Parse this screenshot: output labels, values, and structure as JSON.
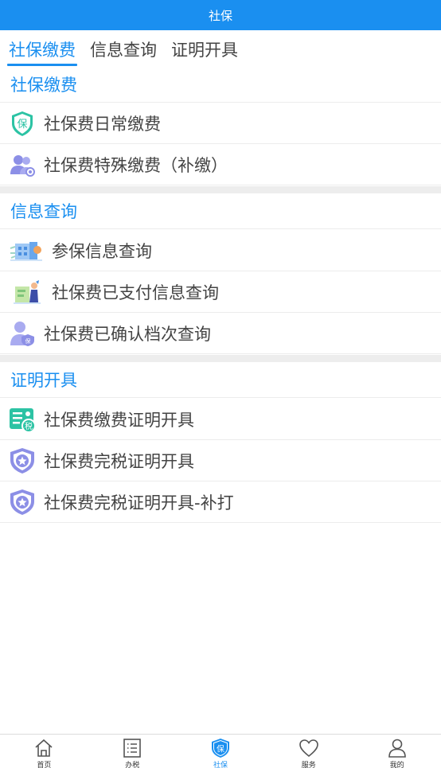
{
  "header": {
    "title": "社保"
  },
  "tabs": [
    {
      "label": "社保缴费",
      "active": true
    },
    {
      "label": "信息查询",
      "active": false
    },
    {
      "label": "证明开具",
      "active": false
    }
  ],
  "sections": [
    {
      "title": "社保缴费",
      "items": [
        {
          "label": "社保费日常缴费",
          "icon": "shield-bao-icon"
        },
        {
          "label": "社保费特殊缴费（补缴）",
          "icon": "people-group-icon"
        }
      ]
    },
    {
      "title": "信息查询",
      "items": [
        {
          "label": "参保信息查询",
          "icon": "building-illustration-icon"
        },
        {
          "label": "社保费已支付信息查询",
          "icon": "person-chart-illustration-icon"
        },
        {
          "label": "社保费已确认档次查询",
          "icon": "user-badge-icon"
        }
      ]
    },
    {
      "title": "证明开具",
      "items": [
        {
          "label": "社保费缴费证明开具",
          "icon": "tax-document-icon"
        },
        {
          "label": "社保费完税证明开具",
          "icon": "star-shield-icon"
        },
        {
          "label": "社保费完税证明开具-补打",
          "icon": "star-shield-icon"
        }
      ]
    }
  ],
  "bottom_nav": [
    {
      "label": "首页",
      "icon": "home-icon",
      "active": false
    },
    {
      "label": "办税",
      "icon": "list-icon",
      "active": false
    },
    {
      "label": "社保",
      "icon": "shield-bao-icon",
      "active": true,
      "icon_text": "保"
    },
    {
      "label": "服务",
      "icon": "heart-icon",
      "active": false
    },
    {
      "label": "我的",
      "icon": "user-icon",
      "active": false
    }
  ],
  "icon_text": {
    "bao": "保",
    "shui": "税",
    "bao_small": "保"
  },
  "colors": {
    "accent": "#1a8ff0",
    "green": "#2cc3a4",
    "purple": "#8c8fe6"
  }
}
